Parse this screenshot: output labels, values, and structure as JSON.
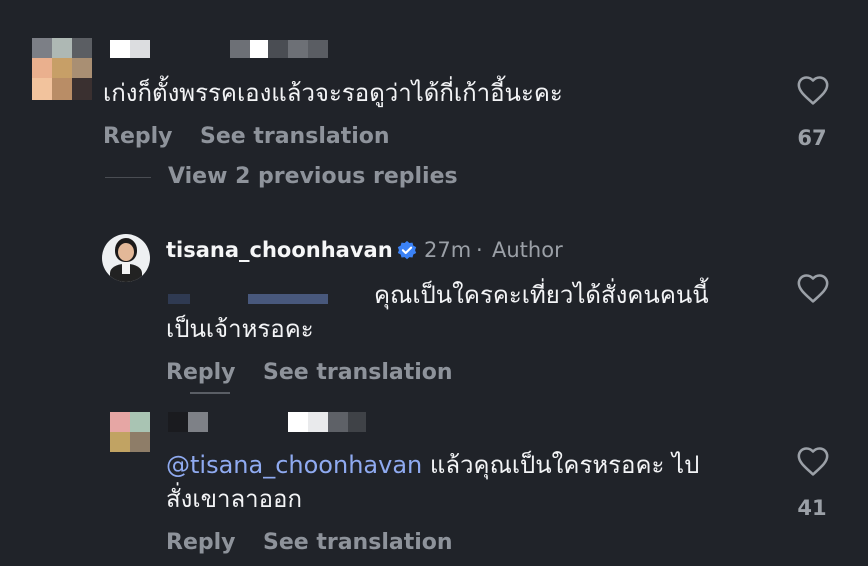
{
  "comment1": {
    "text": "เก่งก็ตั้งพรรคเองแล้วจะรอดูว่าได้กี่เก้าอี้นะคะ",
    "reply_label": "Reply",
    "translate_label": "See translation",
    "like_count": "67",
    "view_replies_label": "View 2 previous replies"
  },
  "comment2": {
    "username": "tisana_choonhavan",
    "time": "27m",
    "separator": "·",
    "author_label": "Author",
    "text_line1": "คุณเป็นใครคะเที่ยวได้สั่งคนคนนี้",
    "text_line2": "เป็นเจ้าหรอคะ",
    "reply_label": "Reply",
    "translate_label": "See translation"
  },
  "comment3": {
    "mention": "@tisana_choonhavan",
    "text_line1": " แล้วคุณเป็นใครหรอคะ ไป",
    "text_line2": "สั่งเขาลาออก",
    "reply_label": "Reply",
    "translate_label": "See translation",
    "like_count": "41"
  },
  "icons": {
    "like": "heart-icon",
    "verified": "verified-badge-icon"
  },
  "colors": {
    "background": "#202329",
    "verified": "#3b82f6",
    "mention": "#8faaf0",
    "muted": "#9ba0a7"
  }
}
